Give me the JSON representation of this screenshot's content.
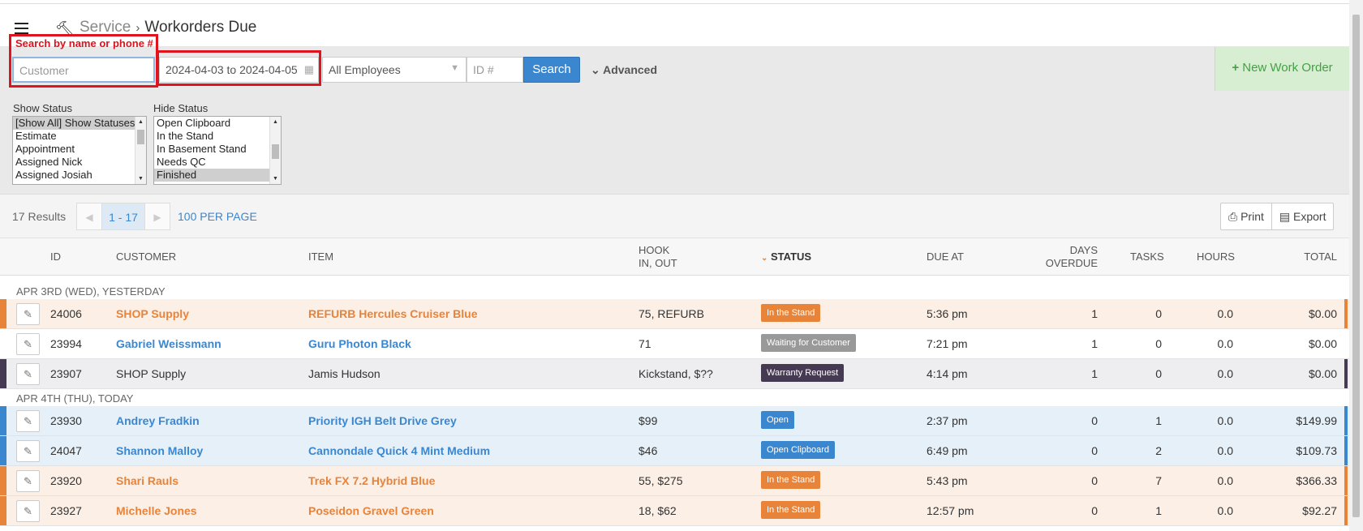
{
  "header": {
    "section": "Service",
    "page": "Workorders Due"
  },
  "search": {
    "hint": "Search by name or phone #",
    "customer_placeholder": "Customer",
    "date_range": "2024-04-03 to 2024-04-05",
    "employees": "All Employees",
    "id_placeholder": "ID #",
    "search_label": "Search",
    "advanced_label": "Advanced",
    "new_work_order": "New Work Order"
  },
  "status_filters": {
    "show_label": "Show Status",
    "show_options": [
      "[Show All] Show Statuses",
      "Estimate",
      "Appointment",
      "Assigned Nick",
      "Assigned Josiah"
    ],
    "hide_label": "Hide Status",
    "hide_options": [
      "Open Clipboard",
      "In the Stand",
      "In Basement Stand",
      "Needs QC",
      "Finished"
    ]
  },
  "paging": {
    "results": "17 Results",
    "range": "1 - 17",
    "per_page": "100 PER PAGE",
    "print": "Print",
    "export": "Export"
  },
  "columns": {
    "id": "ID",
    "customer": "CUSTOMER",
    "item": "ITEM",
    "hook_1": "HOOK",
    "hook_2": "IN, OUT",
    "status": "STATUS",
    "due_at": "DUE AT",
    "overdue_1": "DAYS",
    "overdue_2": "OVERDUE",
    "tasks": "TASKS",
    "hours": "HOURS",
    "total": "TOTAL"
  },
  "groups": [
    {
      "label": "APR 3RD (WED), YESTERDAY",
      "rows": [
        {
          "id": "24006",
          "customer": "SHOP Supply",
          "item": "REFURB Hercules Cruiser Blue",
          "hook": "75, REFURB",
          "status": "In the Stand",
          "due": "5:36 pm",
          "overdue": "1",
          "tasks": "0",
          "hours": "0.0",
          "total": "$0.00"
        },
        {
          "id": "23994",
          "customer": "Gabriel Weissmann",
          "item": "Guru Photon Black",
          "hook": "71",
          "status": "Waiting for Customer",
          "due": "7:21 pm",
          "overdue": "1",
          "tasks": "0",
          "hours": "0.0",
          "total": "$0.00"
        },
        {
          "id": "23907",
          "customer": "SHOP Supply",
          "item": "Jamis Hudson",
          "hook": "Kickstand, $??",
          "status": "Warranty Request",
          "due": "4:14 pm",
          "overdue": "1",
          "tasks": "0",
          "hours": "0.0",
          "total": "$0.00"
        }
      ]
    },
    {
      "label": "APR 4TH (THU), TODAY",
      "rows": [
        {
          "id": "23930",
          "customer": "Andrey Fradkin",
          "item": "Priority IGH Belt Drive Grey",
          "hook": "$99",
          "status": "Open",
          "due": "2:37 pm",
          "overdue": "0",
          "tasks": "1",
          "hours": "0.0",
          "total": "$149.99"
        },
        {
          "id": "24047",
          "customer": "Shannon Malloy",
          "item": "Cannondale Quick 4 Mint Medium",
          "hook": "$46",
          "status": "Open Clipboard",
          "due": "6:49 pm",
          "overdue": "0",
          "tasks": "2",
          "hours": "0.0",
          "total": "$109.73"
        },
        {
          "id": "23920",
          "customer": "Shari Rauls",
          "item": "Trek FX 7.2 Hybrid Blue",
          "hook": "55, $275",
          "status": "In the Stand",
          "due": "5:43 pm",
          "overdue": "0",
          "tasks": "7",
          "hours": "0.0",
          "total": "$366.33"
        },
        {
          "id": "23927",
          "customer": "Michelle Jones",
          "item": "Poseidon Gravel Green",
          "hook": "18, $62",
          "status": "In the Stand",
          "due": "12:57 pm",
          "overdue": "0",
          "tasks": "1",
          "hours": "0.0",
          "total": "$92.27"
        }
      ]
    }
  ],
  "colors": {
    "orange": "#e8833a",
    "orange_bg": "#fcefe6",
    "blue": "#3a87d0",
    "blue_bg": "#e6f0f8",
    "dark": "#453a52",
    "dark_bg": "#eeedef",
    "gray": "#999999"
  }
}
